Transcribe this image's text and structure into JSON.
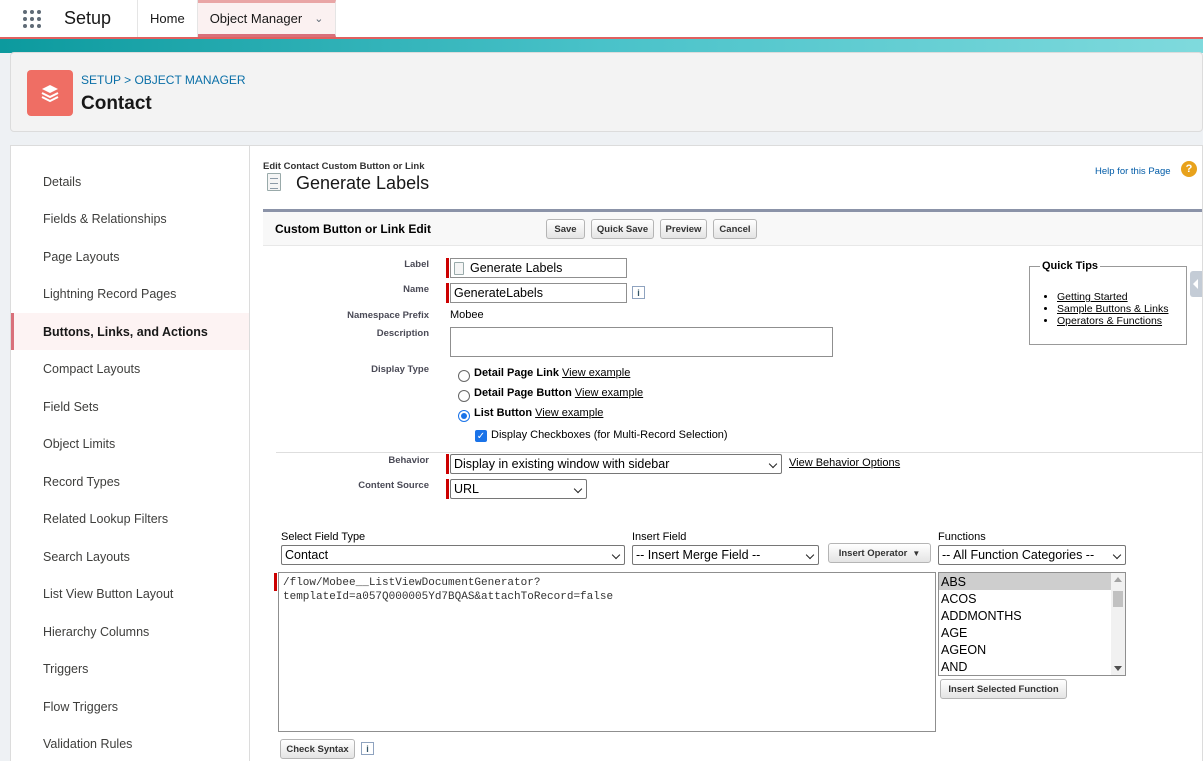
{
  "nav": {
    "app_name": "Setup",
    "tabs": [
      {
        "label": "Home"
      },
      {
        "label": "Object Manager"
      }
    ]
  },
  "header": {
    "breadcrumb": "SETUP > OBJECT MANAGER",
    "title": "Contact",
    "accent_color": "#ef6e64"
  },
  "sidebar": {
    "items": [
      {
        "label": "Details"
      },
      {
        "label": "Fields & Relationships"
      },
      {
        "label": "Page Layouts"
      },
      {
        "label": "Lightning Record Pages"
      },
      {
        "label": "Buttons, Links, and Actions"
      },
      {
        "label": "Compact Layouts"
      },
      {
        "label": "Field Sets"
      },
      {
        "label": "Object Limits"
      },
      {
        "label": "Record Types"
      },
      {
        "label": "Related Lookup Filters"
      },
      {
        "label": "Search Layouts"
      },
      {
        "label": "List View Button Layout"
      },
      {
        "label": "Hierarchy Columns"
      },
      {
        "label": "Triggers"
      },
      {
        "label": "Flow Triggers"
      },
      {
        "label": "Validation Rules"
      }
    ],
    "active": "Buttons, Links, and Actions"
  },
  "page": {
    "subtitle": "Edit Contact Custom Button or Link",
    "title": "Generate Labels",
    "help_link": "Help for this Page",
    "help_icon": "?"
  },
  "block": {
    "title": "Custom Button or Link Edit",
    "buttons": {
      "save": "Save",
      "quick_save": "Quick Save",
      "preview": "Preview",
      "cancel": "Cancel"
    }
  },
  "form": {
    "label_label": "Label",
    "label_value": "Generate Labels",
    "name_label": "Name",
    "name_value": "GenerateLabels",
    "namespace_label": "Namespace Prefix",
    "namespace_value": "Mobee",
    "description_label": "Description",
    "description_value": "",
    "display_type_label": "Display Type",
    "display_types": [
      {
        "label": "Detail Page Link",
        "link": "View example",
        "selected": false
      },
      {
        "label": "Detail Page Button",
        "link": "View example",
        "selected": false
      },
      {
        "label": "List Button",
        "link": "View example",
        "selected": true
      }
    ],
    "display_checkboxes": "Display Checkboxes (for Multi-Record Selection)",
    "display_checkboxes_checked": true,
    "behavior_label": "Behavior",
    "behavior_value": "Display in existing window with sidebar",
    "behavior_link": "View Behavior Options",
    "content_source_label": "Content Source",
    "content_source_value": "URL",
    "info_icon": "i"
  },
  "quick_tips": {
    "title": "Quick Tips",
    "links": [
      "Getting Started",
      "Sample Buttons & Links",
      "Operators & Functions"
    ]
  },
  "editor": {
    "field_type_label": "Select Field Type",
    "field_type_value": "Contact",
    "insert_field_label": "Insert Field",
    "insert_field_value": "-- Insert Merge Field --",
    "insert_operator": "Insert Operator",
    "functions_label": "Functions",
    "functions_category": "-- All Function Categories --",
    "functions": [
      "ABS",
      "ACOS",
      "ADDMONTHS",
      "AGE",
      "AGEON",
      "AND"
    ],
    "selected_function": "ABS",
    "insert_function": "Insert Selected Function",
    "code": "/flow/Mobee__ListViewDocumentGenerator?\ntemplateId=a057Q000005Yd7BQAS&attachToRecord=false",
    "check_syntax": "Check Syntax"
  }
}
